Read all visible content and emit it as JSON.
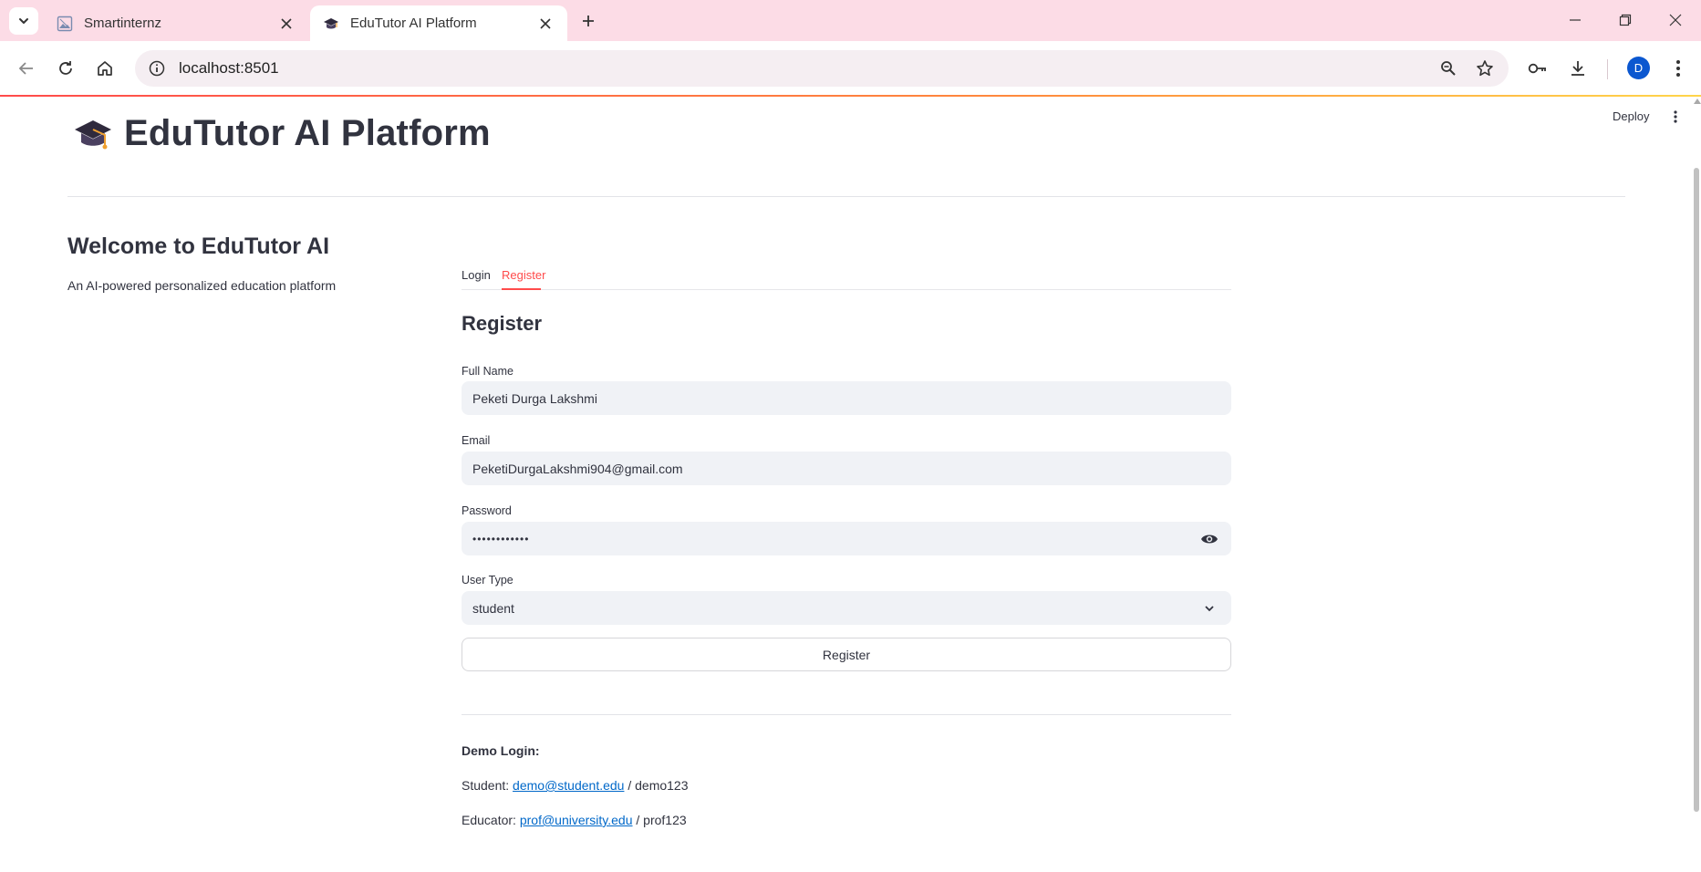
{
  "browser": {
    "tabs": [
      {
        "title": "Smartinternz",
        "active": false
      },
      {
        "title": "EduTutor AI Platform",
        "active": true
      }
    ],
    "url": "localhost:8501",
    "avatar_letter": "D"
  },
  "app": {
    "deploy_label": "Deploy",
    "title": "EduTutor AI Platform",
    "welcome": "Welcome to EduTutor AI",
    "tagline": "An AI-powered personalized education platform",
    "tabs": {
      "login": "Login",
      "register": "Register",
      "active": "Register"
    },
    "form": {
      "title": "Register",
      "full_name_label": "Full Name",
      "full_name_value": "Peketi Durga Lakshmi",
      "email_label": "Email",
      "email_value": "PeketiDurgaLakshmi904@gmail.com",
      "password_label": "Password",
      "password_value": "••••••••••••",
      "user_type_label": "User Type",
      "user_type_value": "student",
      "submit_label": "Register"
    },
    "demo": {
      "heading": "Demo Login:",
      "student_prefix": "Student:",
      "student_email": "demo@student.edu",
      "student_password": "/ demo123",
      "educator_prefix": "Educator:",
      "educator_email": "prof@university.edu",
      "educator_password": "/ prof123"
    }
  },
  "colors": {
    "accent": "#ff4b4b",
    "link": "#0068c9",
    "tabstrip": "#fcdce6",
    "input_bg": "#f0f2f6"
  }
}
